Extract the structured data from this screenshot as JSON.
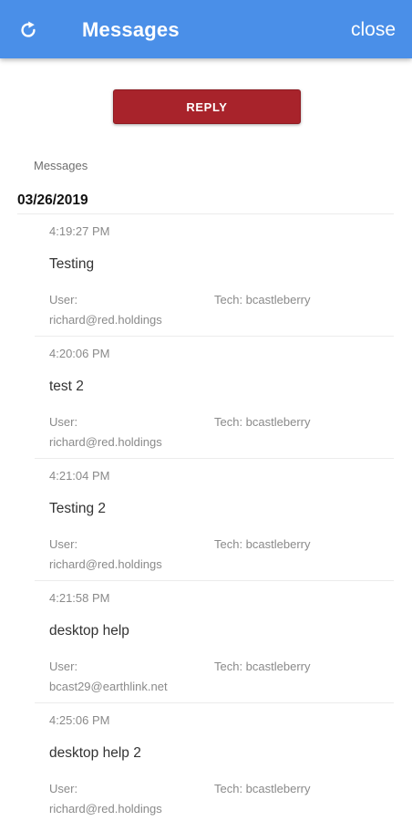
{
  "header": {
    "title": "Messages",
    "close_label": "close",
    "refresh_icon": "refresh-icon",
    "background_color": "#4a8fe8"
  },
  "reply_button": {
    "label": "REPLY",
    "color": "#a8232b"
  },
  "section_label": "Messages",
  "date": "03/26/2019",
  "messages": [
    {
      "time": "4:19:27 PM",
      "text": "Testing",
      "user_label": "User:",
      "user": "richard@red.holdings",
      "tech": "Tech: bcastleberry"
    },
    {
      "time": "4:20:06 PM",
      "text": "test 2",
      "user_label": "User:",
      "user": "richard@red.holdings",
      "tech": "Tech: bcastleberry"
    },
    {
      "time": "4:21:04 PM",
      "text": "Testing 2",
      "user_label": "User:",
      "user": "richard@red.holdings",
      "tech": "Tech: bcastleberry"
    },
    {
      "time": "4:21:58 PM",
      "text": "desktop help",
      "user_label": "User:",
      "user": "bcast29@earthlink.net",
      "tech": "Tech: bcastleberry"
    },
    {
      "time": "4:25:06 PM",
      "text": "desktop help 2",
      "user_label": "User:",
      "user": "richard@red.holdings",
      "tech": "Tech: bcastleberry"
    }
  ]
}
